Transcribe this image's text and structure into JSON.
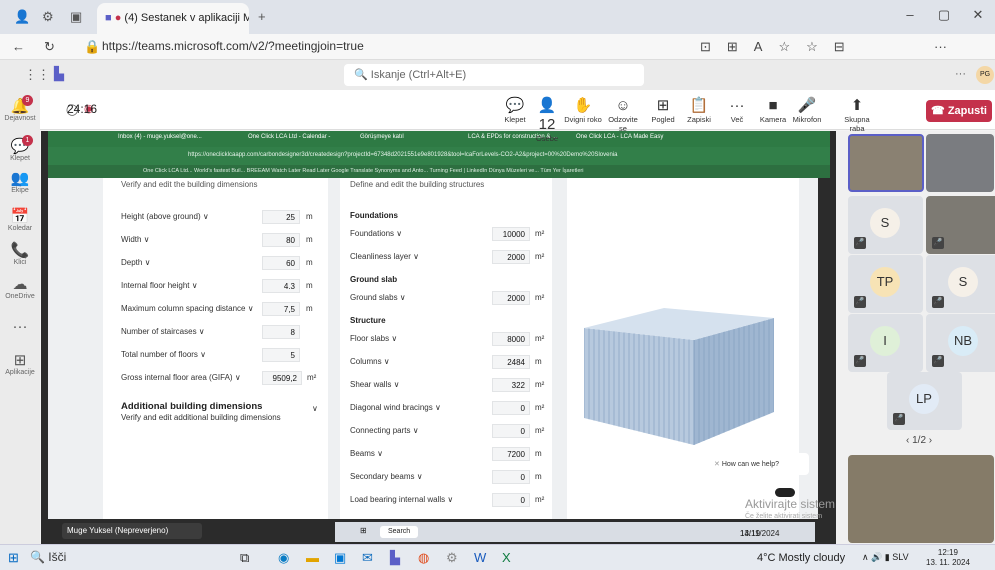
{
  "browser": {
    "tab_title": "(4) Sestanek v aplikaciji Micr",
    "url": "https://teams.microsoft.com/v2/?meetingjoin=true"
  },
  "teams": {
    "search_placeholder": "Iskanje (Ctrl+Alt+E)",
    "time": "24:16",
    "rail": [
      {
        "label": "Dejavnost",
        "glyph": "🔔",
        "badge": "9"
      },
      {
        "label": "Klepet",
        "glyph": "💬",
        "badge": "1"
      },
      {
        "label": "Ekipe",
        "glyph": "👥"
      },
      {
        "label": "Koledar",
        "glyph": "📅"
      },
      {
        "label": "Klici",
        "glyph": "📞"
      },
      {
        "label": "OneDrive",
        "glyph": "☁"
      },
      {
        "label": "",
        "glyph": "···"
      },
      {
        "label": "Aplikacije",
        "glyph": "⊞"
      }
    ],
    "controls": [
      {
        "label": "Klepet",
        "glyph": "💬"
      },
      {
        "label": "Osebe",
        "glyph": "👤",
        "count": "12"
      },
      {
        "label": "Dvigni roko",
        "glyph": "✋"
      },
      {
        "label": "Odzovite se",
        "glyph": "☺"
      },
      {
        "label": "Pogled",
        "glyph": "⊞"
      },
      {
        "label": "Zapiski",
        "glyph": "📋"
      },
      {
        "label": "Več",
        "glyph": "···"
      },
      {
        "label": "Kamera",
        "glyph": "■"
      },
      {
        "label": "Mikrofon",
        "glyph": "🎤"
      },
      {
        "label": "Skupna raba",
        "glyph": "⬆"
      }
    ],
    "leave": "Zapusti"
  },
  "shared": {
    "tabs": [
      "Inbox (4) - muge.yuksel@one...",
      "One Click LCA Ltd - Calendar -",
      "Görüşmeye katıl",
      "LCA & EPDs for construction & ...",
      "One Click LCA - LCA Made Easy"
    ],
    "url": "https://oneclicklcaapp.com/carbondesigner3d/createdesign?projectId=67348d2021551e9e801928&tool=lcaForLevels-CO2-A2&project=00%20Demo%20Slovenia",
    "bookmarks": "One Click LCA Ltd...   World's fastest Buil...   BREEAM   Watch Later   Read Later   Google Translate   Synonyms and Anto...   Turning   Feed | LinkedIn   Dünya Müzeleri ve...   Tüm Yer İşaretleri",
    "col1": {
      "header": "Verify and edit the building dimensions",
      "rows": [
        {
          "label": "Height (above ground) ∨",
          "value": "25",
          "unit": "m"
        },
        {
          "label": "Width ∨",
          "value": "80",
          "unit": "m"
        },
        {
          "label": "Depth ∨",
          "value": "60",
          "unit": "m"
        },
        {
          "label": "Internal floor height ∨",
          "value": "4.3",
          "unit": "m"
        },
        {
          "label": "Maximum column spacing distance ∨",
          "value": "7,5",
          "unit": "m"
        },
        {
          "label": "Number of staircases ∨",
          "value": "8",
          "unit": ""
        },
        {
          "label": "Total number of floors ∨",
          "value": "5",
          "unit": ""
        },
        {
          "label": "Gross internal floor area (GIFA) ∨",
          "value": "9509,2",
          "unit": "m²"
        }
      ],
      "additional_title": "Additional building dimensions",
      "additional_sub": "Verify and edit additional building dimensions"
    },
    "col2": {
      "header": "Define and edit the building structures",
      "sections": [
        {
          "title": "Foundations",
          "rows": [
            {
              "label": "Foundations ∨",
              "value": "10000",
              "unit": "m²"
            },
            {
              "label": "Cleanliness layer ∨",
              "value": "2000",
              "unit": "m²"
            }
          ]
        },
        {
          "title": "Ground slab",
          "rows": [
            {
              "label": "Ground slabs ∨",
              "value": "2000",
              "unit": "m²"
            }
          ]
        },
        {
          "title": "Structure",
          "rows": [
            {
              "label": "Floor slabs ∨",
              "value": "8000",
              "unit": "m²"
            },
            {
              "label": "Columns ∨",
              "value": "2484",
              "unit": "m"
            },
            {
              "label": "Shear walls ∨",
              "value": "322",
              "unit": "m²"
            },
            {
              "label": "Diagonal wind bracings ∨",
              "value": "0",
              "unit": "m²"
            },
            {
              "label": "Connecting parts ∨",
              "value": "0",
              "unit": "m²"
            },
            {
              "label": "Beams ∨",
              "value": "7200",
              "unit": "m"
            },
            {
              "label": "Secondary beams ∨",
              "value": "0",
              "unit": "m"
            },
            {
              "label": "Load bearing internal walls ∨",
              "value": "0",
              "unit": "m²"
            }
          ]
        }
      ]
    },
    "chat": "How can we help?",
    "watermark": "Aktivirajte sistem",
    "watermark_sub": "Če želite aktivirati sistem",
    "presenter": "Muge Yuksel (Nepreverjeno)",
    "inner_search": "Search",
    "inner_time": "14:19",
    "inner_date": "13/11/2024"
  },
  "participants": [
    "S",
    "TP",
    "S",
    "I",
    "NB",
    "LP"
  ],
  "pager": "1/2",
  "taskbar": {
    "search": "Išči",
    "weather": "4°C Mostly cloudy",
    "lang": "SLV",
    "time": "12:19",
    "date": "13. 11. 2024"
  }
}
